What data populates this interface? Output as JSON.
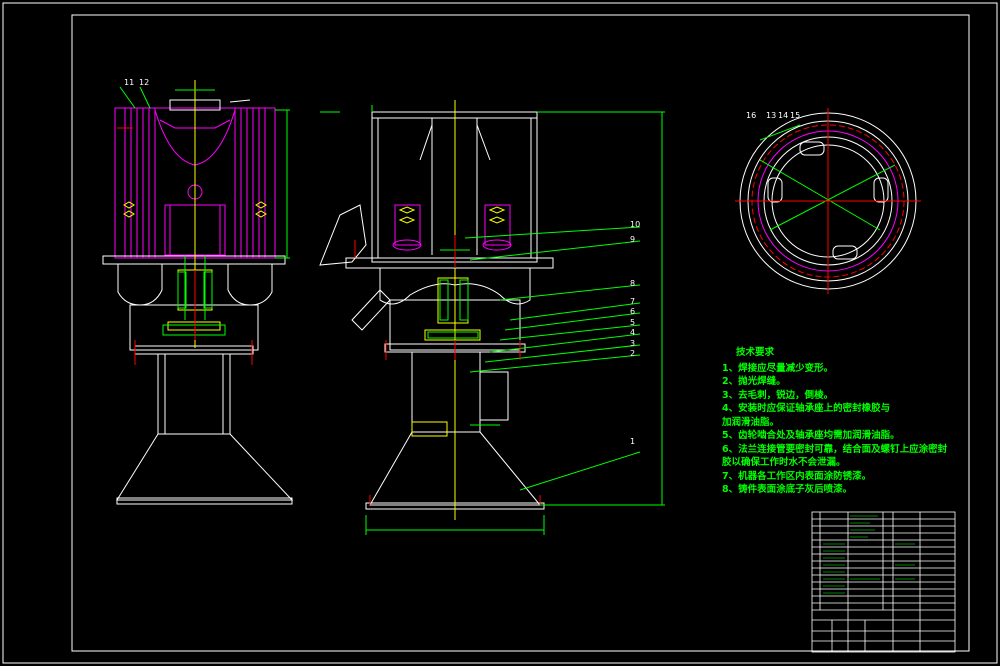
{
  "view_left_labels": [
    "11",
    "12"
  ],
  "view_section_labels": [
    "10",
    "9",
    "8",
    "7",
    "6",
    "5",
    "4",
    "3",
    "2",
    "1"
  ],
  "view_top_labels": [
    "16",
    "13",
    "14",
    "15"
  ],
  "notes": {
    "title": "技术要求",
    "items": [
      "1、焊接应尽量减少变形。",
      "2、抛光焊缝。",
      "3、去毛刺，锐边，倒棱。",
      "4、安装时应保证轴承座上的密封橡胶与",
      "加润滑油脂。",
      "5、齿轮啮合处及轴承座均需加润滑油脂。",
      "6、法兰连接管要密封可靠，结合面及螺钉上应涂密封",
      "胶以确保工作时水不会泄漏。",
      "7、机器各工作区内表面涂防锈漆。",
      "8、铸件表面涂底子灰后喷漆。"
    ]
  },
  "title_block": {
    "rows": 15
  }
}
